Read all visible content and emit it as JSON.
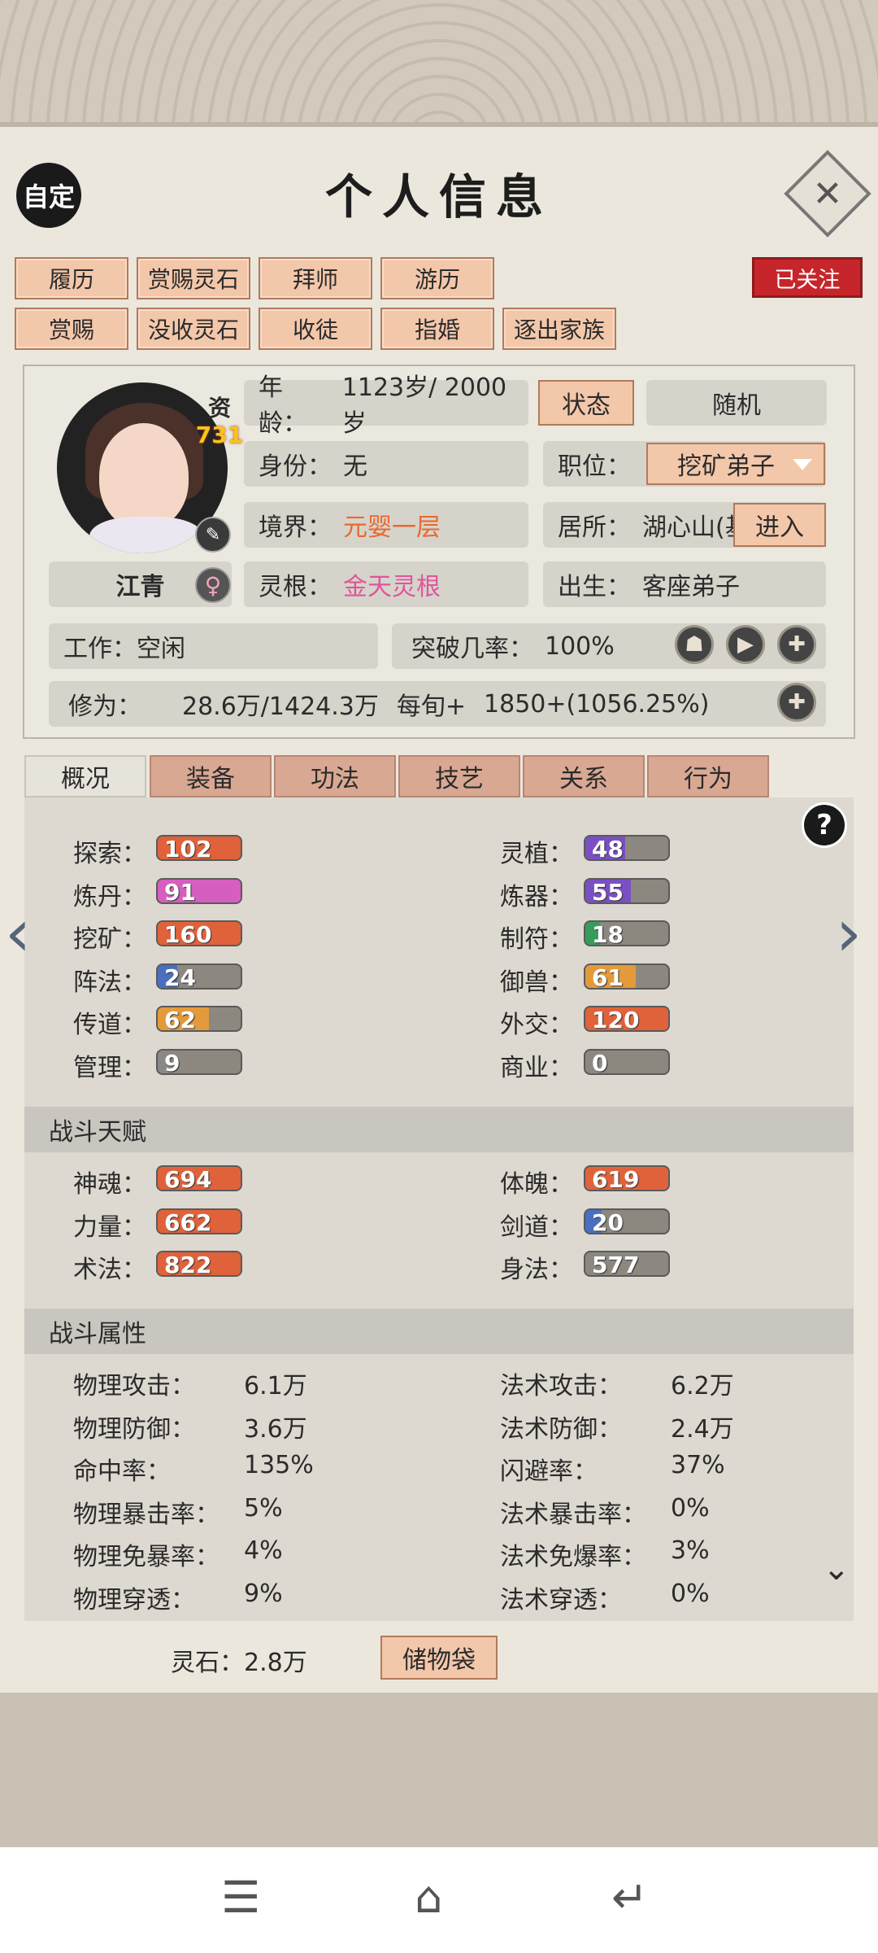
{
  "header": {
    "custom_label": "自定",
    "title": "个人信息",
    "close_icon": "close-icon"
  },
  "actions": {
    "row1": [
      "履历",
      "赏赐灵石",
      "拜师",
      "游历"
    ],
    "row2": [
      "赏赐",
      "没收灵石",
      "收徒",
      "指婚",
      "逐出家族"
    ],
    "follow_label": "已关注"
  },
  "profile": {
    "zi_label": "资",
    "zi_value": "731",
    "name": "江青",
    "age_label": "年龄：",
    "age_value": "1123岁/ 2000岁",
    "status_button": "状态",
    "random_label": "随机",
    "identity_label": "身份：",
    "identity_value": "无",
    "position_label": "职位：",
    "position_value": "挖矿弟子",
    "realm_label": "境界：",
    "realm_value": "元婴一层",
    "residence_label": "居所：",
    "residence_value": "湖心山(基",
    "enter_button": "进入",
    "root_label": "灵根：",
    "root_value": "金天灵根",
    "birth_label": "出生：",
    "birth_value": "客座弟子",
    "work_label": "工作：",
    "work_value": "空闲",
    "breakthrough_label": "突破几率：",
    "breakthrough_value": "100%",
    "cultivation_label": "修为：",
    "cultivation_value": "28.6万/1424.3万",
    "per_turn_label": "每旬+",
    "per_turn_value": "1850+(1056.25%)"
  },
  "tabs": [
    "概况",
    "装备",
    "功法",
    "技艺",
    "关系",
    "行为"
  ],
  "talents_left": [
    {
      "label": "探索：",
      "value": "102",
      "color": "#e0623b",
      "fill": 1.0
    },
    {
      "label": "炼丹：",
      "value": "91",
      "color": "#d65ec0",
      "fill": 1.0
    },
    {
      "label": "挖矿：",
      "value": "160",
      "color": "#e0623b",
      "fill": 1.0
    },
    {
      "label": "阵法：",
      "value": "24",
      "color": "#4a6fc0",
      "fill": 0.24
    },
    {
      "label": "传道：",
      "value": "62",
      "color": "#e39a3b",
      "fill": 0.62
    },
    {
      "label": "管理：",
      "value": "9",
      "color": "#888",
      "fill": 0.09
    }
  ],
  "talents_right": [
    {
      "label": "灵植：",
      "value": "48",
      "color": "#7a4fc4",
      "fill": 0.48
    },
    {
      "label": "炼器：",
      "value": "55",
      "color": "#7a4fc4",
      "fill": 0.55
    },
    {
      "label": "制符：",
      "value": "18",
      "color": "#3a9a5a",
      "fill": 0.18
    },
    {
      "label": "御兽：",
      "value": "61",
      "color": "#e39a3b",
      "fill": 0.61
    },
    {
      "label": "外交：",
      "value": "120",
      "color": "#e0623b",
      "fill": 1.0
    },
    {
      "label": "商业：",
      "value": "0",
      "color": "#888",
      "fill": 0
    }
  ],
  "combat_talent_header": "战斗天赋",
  "combat_left": [
    {
      "label": "神魂：",
      "value": "694",
      "color": "#e0623b",
      "fill": 1.0
    },
    {
      "label": "力量：",
      "value": "662",
      "color": "#e0623b",
      "fill": 1.0
    },
    {
      "label": "术法：",
      "value": "822",
      "color": "#e0623b",
      "fill": 1.0
    }
  ],
  "combat_right": [
    {
      "label": "体魄：",
      "value": "619",
      "color": "#e0623b",
      "fill": 1.0
    },
    {
      "label": "剑道：",
      "value": "20",
      "color": "#4a6fc0",
      "fill": 0.2
    },
    {
      "label": "身法：",
      "value": "577",
      "color": "#888",
      "fill": 0
    }
  ],
  "combat_attr_header": "战斗属性",
  "attrs_left": [
    {
      "label": "物理攻击：",
      "value": "6.1万"
    },
    {
      "label": "物理防御：",
      "value": "3.6万"
    },
    {
      "label": "命中率：",
      "value": "135%"
    },
    {
      "label": "物理暴击率：",
      "value": "5%"
    },
    {
      "label": "物理免暴率：",
      "value": "4%"
    },
    {
      "label": "物理穿透：",
      "value": "9%"
    }
  ],
  "attrs_right": [
    {
      "label": "法术攻击：",
      "value": "6.2万"
    },
    {
      "label": "法术防御：",
      "value": "2.4万"
    },
    {
      "label": "闪避率：",
      "value": "37%"
    },
    {
      "label": "法术暴击率：",
      "value": "0%"
    },
    {
      "label": "法术免爆率：",
      "value": "3%"
    },
    {
      "label": "法术穿透：",
      "value": "0%"
    }
  ],
  "footer": {
    "stone_label": "灵石：",
    "stone_value": "2.8万",
    "bag_button": "储物袋"
  },
  "icons": {
    "help": "?",
    "prev": "‹",
    "next": "›"
  }
}
